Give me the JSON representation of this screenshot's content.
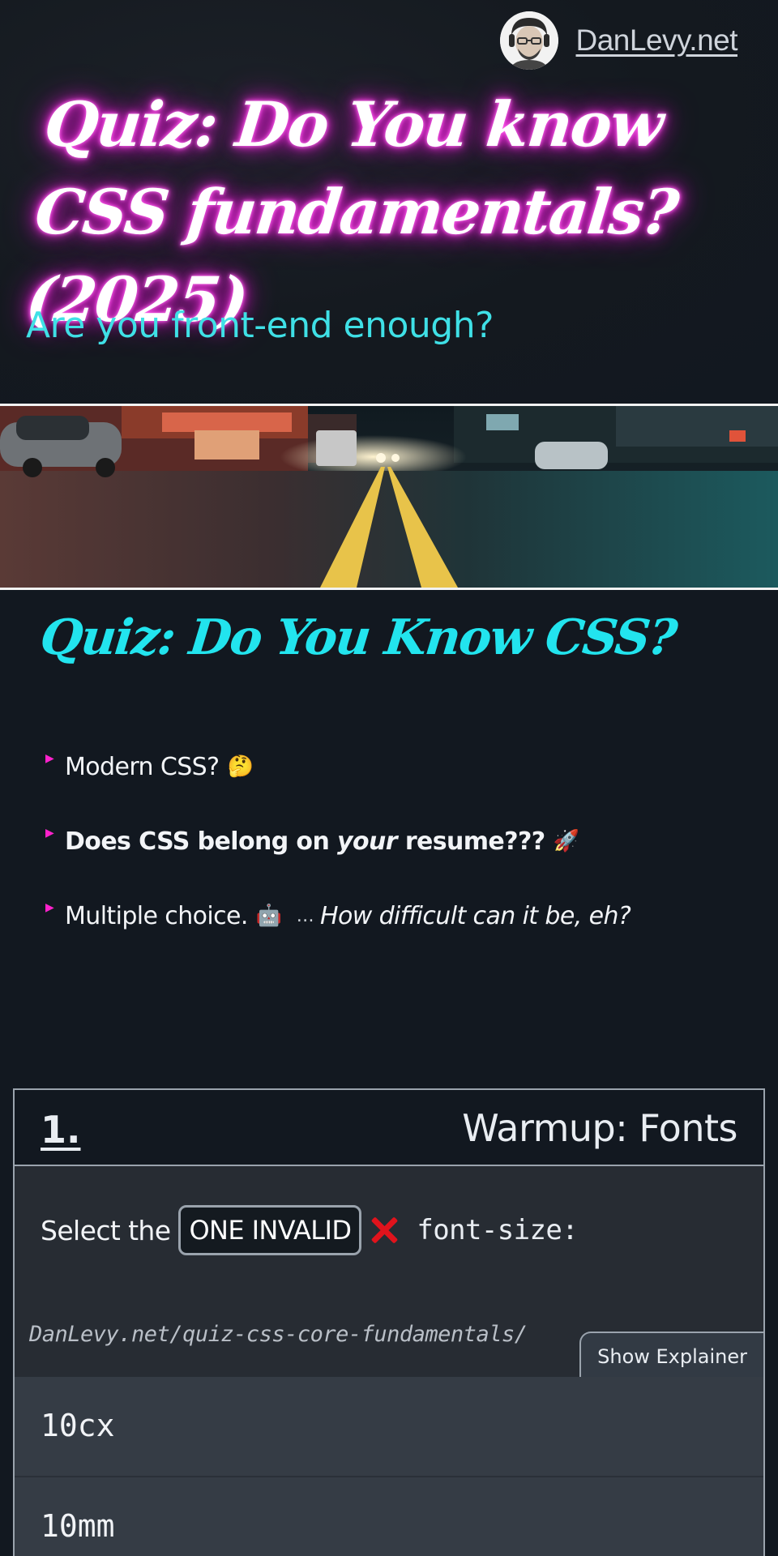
{
  "header": {
    "site_name": "DanLevy.net",
    "avatar_alt": "Dan Levy avatar",
    "title": "Quiz: Do You know CSS fundamentals? (2025)",
    "subtitle": "Are you front-end enough?"
  },
  "intro": {
    "title": "Quiz: Do You Know CSS?",
    "items": [
      {
        "text": "Modern CSS?",
        "emoji": "🤔"
      },
      {
        "text_before": "Does CSS belong on ",
        "text_em": "your",
        "text_after": " resume???",
        "emoji": "🚀"
      },
      {
        "text": "Multiple choice.",
        "emoji": "🤖",
        "dots": "…",
        "aside": "How difficult can it be, eh?"
      }
    ]
  },
  "quiz": {
    "number": "1.",
    "category": "Warmup: Fonts",
    "prompt_prefix": "Select the",
    "prompt_pill": "ONE INVALID",
    "prompt_code": "font-size:",
    "url": "DanLevy.net/quiz-css-core-fundamentals/",
    "explainer_button": "Show Explainer",
    "options": [
      "10cx",
      "10mm"
    ]
  },
  "colors": {
    "background": "#121820",
    "neon_pink": "#ff3fe6",
    "cyan": "#22e4ee",
    "error_red": "#e0131c",
    "bullet_pink": "#ff22cc"
  },
  "icons": {
    "invalid": "x-mark-icon",
    "bullet": "triangle-bullet-icon"
  }
}
